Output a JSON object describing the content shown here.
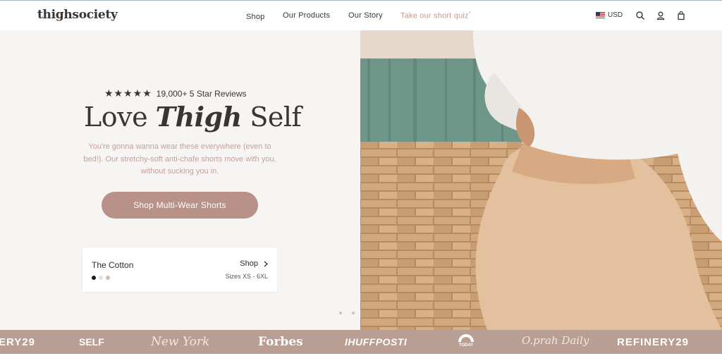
{
  "header": {
    "logo": "thighsociety",
    "nav": {
      "shop": "Shop",
      "products": "Our Products",
      "story": "Our Story",
      "quiz": "Take our short quiz",
      "quiz_mark": "*"
    },
    "currency": "USD",
    "icons": [
      "flag-us-icon",
      "search-icon",
      "account-icon",
      "bag-icon"
    ]
  },
  "hero": {
    "stars": "★★★★★",
    "reviews": "19,000+ 5 Star Reviews",
    "headline_1": "Love",
    "headline_2": "Thigh",
    "headline_3": "Self",
    "subtext": "You're gonna wanna wear these everywhere (even to bed!). Our stretchy-soft anti-chafe shorts move with you, without sucking you in.",
    "cta": "Shop Multi-Wear Shorts",
    "card": {
      "title": "The Cotton",
      "shop": "Shop",
      "sizes": "Sizes XS - 6XL",
      "swatches": [
        "#1a1a1a",
        "#e9dfd6",
        "#cdbcb2"
      ]
    },
    "slides": {
      "count": 3,
      "active": 3
    }
  },
  "press": [
    "ERY29",
    "SELF",
    "New York",
    "Forbes",
    "IHUFFPOSTI",
    "TODAY",
    "O.prah Daily",
    "REFINERY29"
  ],
  "colors": {
    "accent": "#b89189",
    "subtext": "#c4a097",
    "press_strip": "#b99e93",
    "hero_bg": "#f7f5f3"
  }
}
